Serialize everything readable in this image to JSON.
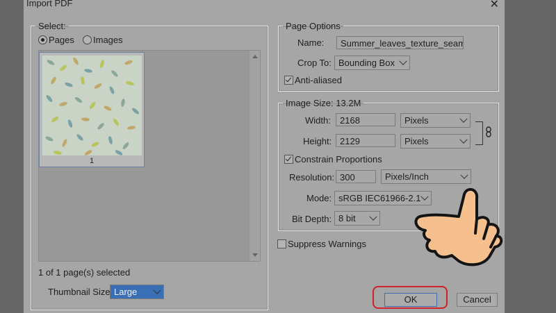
{
  "window": {
    "title": "Import PDF",
    "close_symbol": "✕"
  },
  "select_group": {
    "legend": "Select:",
    "options": [
      {
        "label": "Pages",
        "selected": true
      },
      {
        "label": "Images",
        "selected": false
      }
    ],
    "thumbnail_page_number": "1",
    "status_text": "1 of 1 page(s) selected",
    "thumbnail_size": {
      "label": "Thumbnail Size:",
      "value": "Large"
    }
  },
  "page_options": {
    "legend": "Page Options",
    "name_label": "Name:",
    "name_value": "Summer_leaves_texture_seamle",
    "crop_to_label": "Crop To:",
    "crop_to_value": "Bounding Box",
    "anti_aliased_label": "Anti-aliased",
    "anti_aliased_checked": true
  },
  "image_size": {
    "legend": "Image Size: 13.2M",
    "width_label": "Width:",
    "width_value": "2168",
    "width_unit": "Pixels",
    "height_label": "Height:",
    "height_value": "2129",
    "height_unit": "Pixels",
    "constrain_label": "Constrain Proportions",
    "constrain_checked": true,
    "resolution_label": "Resolution:",
    "resolution_value": "300",
    "resolution_unit": "Pixels/Inch",
    "mode_label": "Mode:",
    "mode_value": "sRGB IEC61966-2.1",
    "bit_depth_label": "Bit Depth:",
    "bit_depth_value": "8 bit"
  },
  "suppress_warnings": {
    "label": "Suppress Warnings",
    "checked": false
  },
  "buttons": {
    "ok": "OK",
    "cancel": "Cancel"
  },
  "icons": {
    "link": "chain-link-icon",
    "pointer": "pointing-hand-icon"
  },
  "colors": {
    "highlight": "#d0202a",
    "thumbnail_bg": "#c8d2c4"
  }
}
